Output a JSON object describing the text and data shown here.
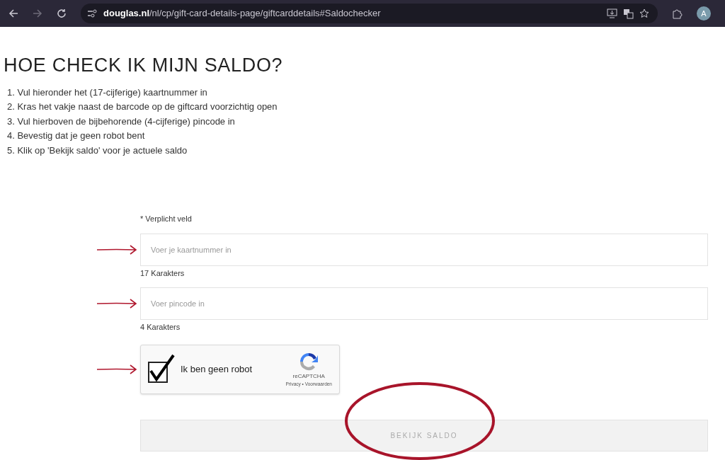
{
  "browser": {
    "url": "**douglas.nl**/nl/cp/gift-card-details-page/giftcarddetails#Saldochecker",
    "avatar": "A"
  },
  "heading": "HOE CHECK IK MIJN SALDO?",
  "steps": [
    "1. Vul hieronder het (17-cijferige) kaartnummer in",
    "2. Kras het vakje naast de barcode op de giftcard voorzichtig open",
    "3. Vul hierboven de bijbehorende (4-cijferige) pincode in",
    "4. Bevestig dat je geen robot bent",
    "5. Klik op 'Bekijk saldo' voor je actuele saldo"
  ],
  "form": {
    "required_note": "* Verplicht veld",
    "fields": [
      {
        "placeholder": "Voer je kaartnummer in",
        "hint": "17 Karakters"
      },
      {
        "placeholder": "Voer pincode in",
        "hint": "4 Karakters"
      }
    ],
    "captcha": {
      "label": "Ik ben geen robot",
      "checked": true,
      "brand": "reCAPTCHA",
      "links": "Privacy • Voorwaarden"
    },
    "submit": {
      "label": "BEKIJK SALDO",
      "disabled": true
    }
  }
}
